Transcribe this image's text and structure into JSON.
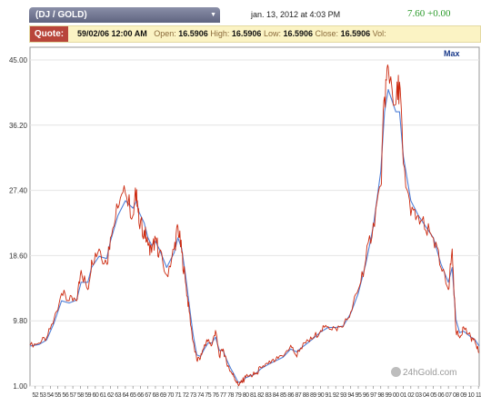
{
  "header": {
    "symbol": "(DJ / GOLD)",
    "dropdown_glyph": "▼",
    "datetime": "jan. 13, 2012 at 4:03 PM",
    "price": "7.60 +0.00"
  },
  "quote": {
    "label": "Quote:",
    "date": "59/02/06 12:00 AM",
    "open_label": "Open:",
    "open": "16.5906",
    "high_label": "High:",
    "high": "16.5906",
    "low_label": "Low:",
    "low": "16.5906",
    "close_label": "Close:",
    "close": "16.5906",
    "vol_label": "Vol:"
  },
  "range_button": "Max",
  "watermark": "24hGold.com",
  "colors": {
    "price_line": "#cc2a10",
    "average_line": "#4f80d8",
    "grid": "#e4e4e4",
    "quote_bg": "#fbf3c4",
    "quote_label_bg": "#b8453a",
    "price_text": "#2a9a2a"
  },
  "chart_data": {
    "type": "line",
    "title": "",
    "xlabel": "",
    "ylabel": "",
    "ylim": [
      1.0,
      45.0
    ],
    "yticks": [
      "1.00",
      "9.80",
      "18.60",
      "27.40",
      "36.20",
      "45.00"
    ],
    "xlim": [
      1952.3,
      2012.1
    ],
    "xticks": [
      "52",
      "53",
      "54",
      "55",
      "56",
      "57",
      "58",
      "59",
      "60",
      "61",
      "62",
      "63",
      "64",
      "65",
      "66",
      "67",
      "68",
      "69",
      "70",
      "71",
      "72",
      "73",
      "74",
      "75",
      "76",
      "77",
      "78",
      "79",
      "80",
      "81",
      "82",
      "83",
      "84",
      "85",
      "86",
      "87",
      "88",
      "89",
      "90",
      "91",
      "92",
      "93",
      "94",
      "95",
      "96",
      "97",
      "98",
      "99",
      "00",
      "01",
      "02",
      "03",
      "04",
      "05",
      "06",
      "07",
      "08",
      "09",
      "10",
      "11",
      "12"
    ],
    "grid": true,
    "series": [
      {
        "role": "price",
        "x": [
          1952.3,
          1953.5,
          1954.5,
          1955.5,
          1956.5,
          1957.5,
          1958.5,
          1959.1,
          1960,
          1960.5,
          1961.5,
          1962.5,
          1963,
          1964,
          1965,
          1966,
          1966.5,
          1966.8,
          1967.5,
          1968,
          1968.5,
          1969,
          1969.5,
          1970.5,
          1971.5,
          1972,
          1972.5,
          1973,
          1973.5,
          1974,
          1974.5,
          1975,
          1975.5,
          1976,
          1976.5,
          1977,
          1977.5,
          1978,
          1978.5,
          1979,
          1979.5,
          1980,
          1980.5,
          1981,
          1982,
          1982.5,
          1983,
          1984,
          1985,
          1986,
          1987,
          1987.8,
          1988,
          1989,
          1990,
          1991,
          1992,
          1993,
          1994,
          1995,
          1996,
          1997,
          1998,
          1999,
          1999.5,
          2000,
          2001,
          2001.5,
          2002,
          2003,
          2004,
          2005,
          2006,
          2007,
          2008,
          2008.5,
          2009,
          2009.5,
          2010,
          2011,
          2011.5,
          2012.1
        ],
        "y": [
          6.5,
          6.8,
          7.5,
          10,
          13.5,
          12.5,
          12.5,
          16.6,
          14,
          18,
          19.5,
          17.5,
          21,
          25,
          27,
          24,
          27.5,
          23,
          22,
          20,
          19,
          21,
          19,
          16,
          19.5,
          22.5,
          19,
          15,
          11,
          7,
          4.5,
          4.8,
          6.5,
          7.2,
          6.5,
          8.5,
          5,
          6,
          4,
          3,
          2.2,
          1.2,
          1.5,
          2.2,
          2.5,
          2.8,
          3.5,
          4,
          4.5,
          5,
          6.5,
          5,
          5.8,
          6.8,
          7.5,
          8.5,
          9,
          8.8,
          9,
          11,
          14,
          18,
          23,
          28,
          40,
          44,
          39,
          42,
          31,
          24,
          24,
          22,
          21,
          17,
          14,
          19.5,
          8.5,
          7.5,
          9,
          7.5,
          7.2,
          5.5
        ]
      },
      {
        "role": "moving-average",
        "x": [
          1952.3,
          1953.5,
          1954.5,
          1955.5,
          1956.5,
          1957.5,
          1958.5,
          1959.1,
          1960,
          1960.5,
          1961.5,
          1962.5,
          1963,
          1964,
          1965,
          1966,
          1966.5,
          1966.8,
          1967.5,
          1968,
          1968.5,
          1969,
          1969.5,
          1970.5,
          1971.5,
          1972,
          1972.5,
          1973,
          1973.5,
          1974,
          1974.5,
          1975,
          1975.5,
          1976,
          1976.5,
          1977,
          1977.5,
          1978,
          1978.5,
          1979,
          1979.5,
          1980,
          1980.5,
          1981,
          1982,
          1982.5,
          1983,
          1984,
          1985,
          1986,
          1987,
          1987.8,
          1988,
          1989,
          1990,
          1991,
          1992,
          1993,
          1994,
          1995,
          1996,
          1997,
          1998,
          1999,
          1999.5,
          2000,
          2001,
          2001.5,
          2002,
          2003,
          2004,
          2005,
          2006,
          2007,
          2008,
          2008.5,
          2009,
          2009.5,
          2010,
          2011,
          2011.5,
          2012.1
        ],
        "y": [
          6.4,
          6.6,
          7.2,
          9.5,
          12.5,
          12.2,
          12.6,
          15,
          15,
          17,
          18.5,
          18.2,
          20.5,
          24,
          26,
          25,
          26,
          24.5,
          23,
          21,
          20,
          20.5,
          19.5,
          17,
          19,
          21,
          19.5,
          16,
          12,
          8,
          5.2,
          5,
          6,
          6.8,
          6.8,
          7.6,
          5.8,
          5.8,
          4.5,
          3.4,
          2.5,
          1.5,
          1.6,
          2.1,
          2.5,
          2.8,
          3.3,
          3.9,
          4.4,
          4.9,
          6,
          5.6,
          5.8,
          6.6,
          7.4,
          8.3,
          8.9,
          8.9,
          9.1,
          10.8,
          13.5,
          17.5,
          22.5,
          30,
          38,
          41,
          38,
          38,
          32,
          26,
          24,
          22.5,
          21,
          17.5,
          15,
          17,
          10,
          8.2,
          8.4,
          7.6,
          7.3,
          6.4
        ]
      }
    ]
  }
}
